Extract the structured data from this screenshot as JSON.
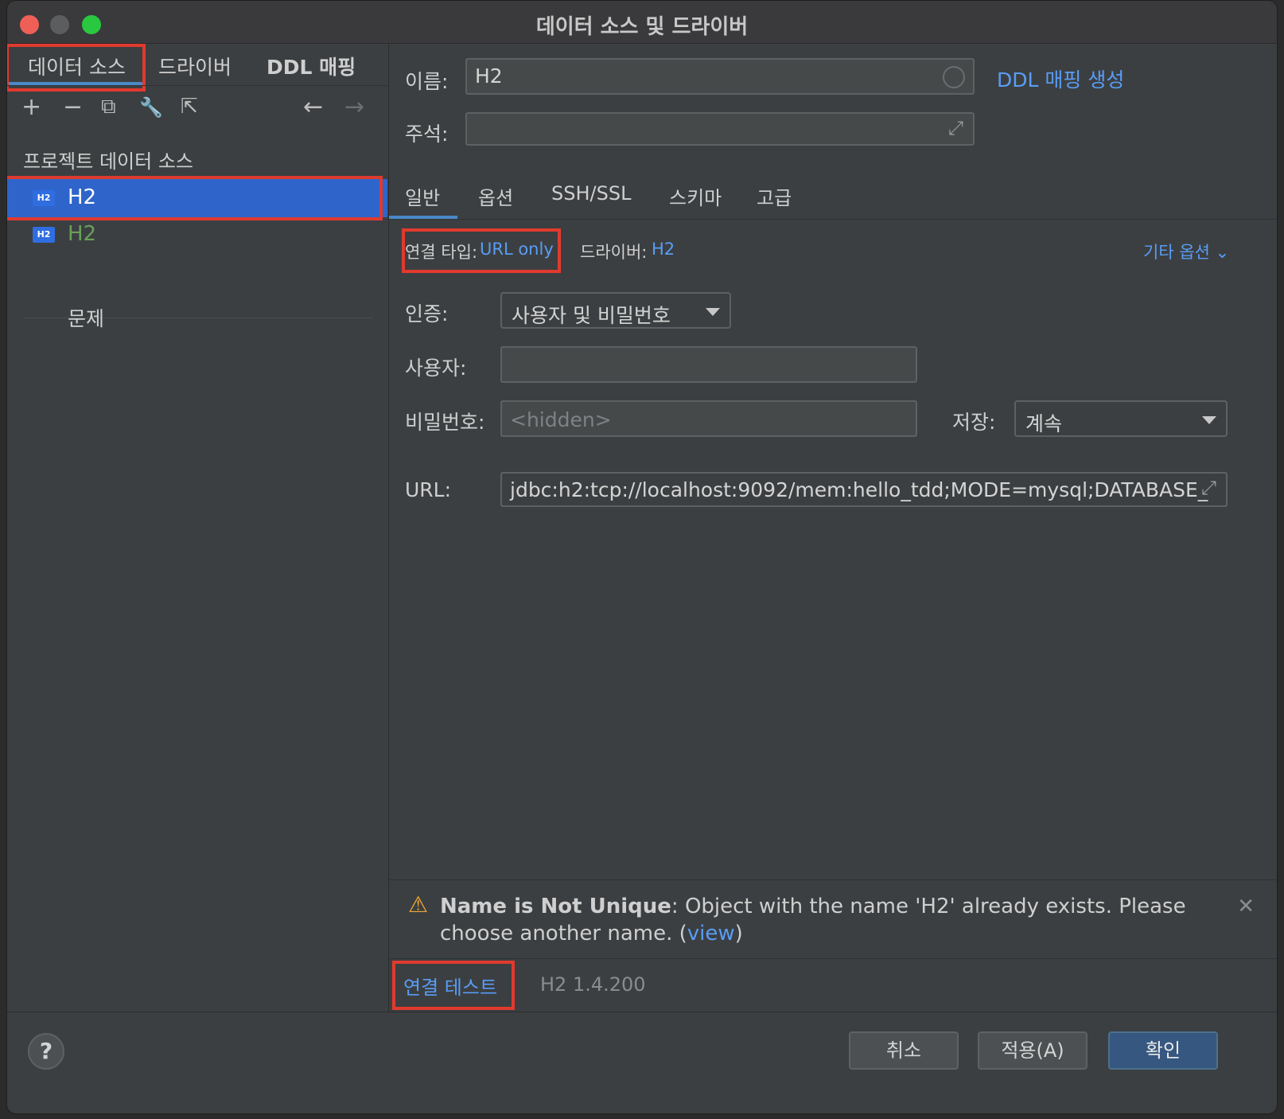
{
  "window": {
    "title": "데이터 소스 및 드라이버"
  },
  "sidebar": {
    "tabs": [
      "데이터 소스",
      "드라이버",
      "DDL 매핑"
    ],
    "toolbar": {
      "add": "+",
      "remove": "−",
      "copy": "⧉",
      "settings": "🔧",
      "export": "⇱",
      "back": "←",
      "forward": "→"
    },
    "section_title": "프로젝트 데이터 소스",
    "items": [
      {
        "badge": "H2",
        "label": "H2",
        "selected": true
      },
      {
        "badge": "H2",
        "label": "H2",
        "selected": false
      }
    ],
    "problems_label": "문제"
  },
  "main": {
    "name_label": "이름:",
    "name_value": "H2",
    "ddl_link": "DDL 매핑 생성",
    "comment_label": "주석:",
    "comment_value": "",
    "tabs": [
      "일반",
      "옵션",
      "SSH/SSL",
      "스키마",
      "고급"
    ],
    "connection_type_label": "연결 타입:",
    "connection_type_value": "URL only",
    "driver_label": "드라이버:",
    "driver_value": "H2",
    "other_options": "기타 옵션",
    "auth_label": "인증:",
    "auth_value": "사용자 및 비밀번호",
    "user_label": "사용자:",
    "user_value": "",
    "password_label": "비밀번호:",
    "password_placeholder": "<hidden>",
    "save_label": "저장:",
    "save_value": "계속",
    "url_label": "URL:",
    "url_value": "jdbc:h2:tcp://localhost:9092/mem:hello_tdd;MODE=mysql;DATABASE_",
    "warning": {
      "title": "Name is Not Unique",
      "message": ": Object with the name 'H2' already exists. Please choose another name. (",
      "link": "view",
      "suffix": ")"
    },
    "test_connection": "연결 테스트",
    "driver_version": "H2 1.4.200"
  },
  "footer": {
    "help": "?",
    "cancel": "취소",
    "apply": "적용(A)",
    "ok": "확인"
  },
  "colors": {
    "accent": "#589df6",
    "selection": "#2f65ca",
    "highlight_box": "#e03a2f",
    "inactive_item": "#6a9f5a"
  }
}
